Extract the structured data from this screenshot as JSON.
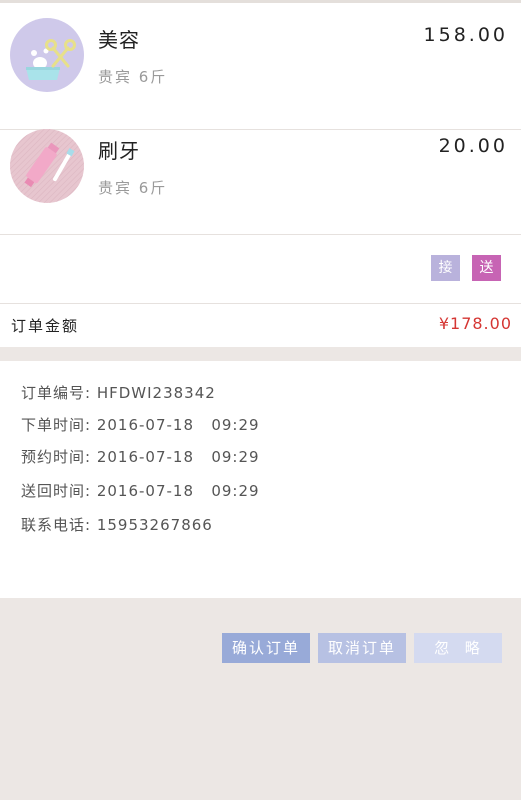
{
  "services": [
    {
      "name": "美容",
      "sub": "贵宾  6斤",
      "price": "158.00",
      "icon": "scissors-soap-icon"
    },
    {
      "name": "刷牙",
      "sub": "贵宾  6斤",
      "price": "20.00",
      "icon": "toothbrush-icon"
    }
  ],
  "tags": {
    "pickup": "接",
    "delivery": "送"
  },
  "total": {
    "label": "订单金额",
    "value": "¥178.00"
  },
  "info": {
    "order_no_label": "订单编号:",
    "order_no": "HFDWI238342",
    "order_time_label": "下单时间:",
    "order_time": "2016-07-18   09:29",
    "appoint_time_label": "预约时间:",
    "appoint_time": "2016-07-18   09:29",
    "return_time_label": "送回时间:",
    "return_time": "2016-07-18   09:29",
    "phone_label": "联系电话:",
    "phone": "15953267866"
  },
  "buttons": {
    "confirm": "确认订单",
    "cancel": "取消订单",
    "ignore": "忽  略"
  },
  "colors": {
    "price_red": "#d53633",
    "tag_pickup": "#b9b2dc",
    "tag_delivery": "#c764b4",
    "btn_confirm": "#98aad8",
    "btn_cancel": "#b7c1e3",
    "btn_ignore": "#d4daf0"
  }
}
